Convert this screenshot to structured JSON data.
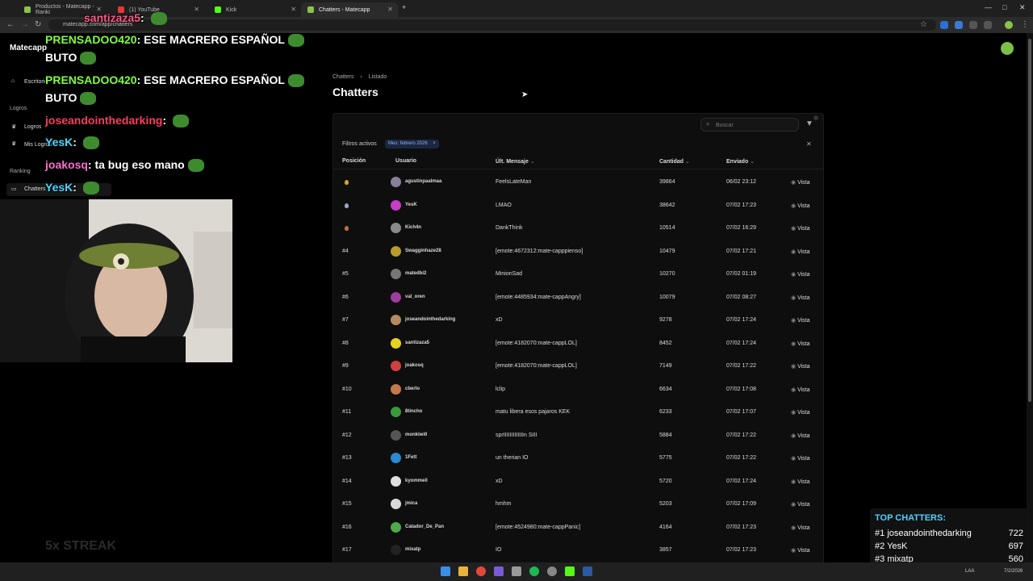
{
  "browser": {
    "tabs": [
      {
        "label": "Productos - Matecapp - Ranki",
        "active": false
      },
      {
        "label": "(1) YouTube",
        "active": false
      },
      {
        "label": "Kick",
        "active": false
      },
      {
        "label": "Chatters - Matecapp",
        "active": true
      }
    ],
    "url": "matecapp.com/app/chatters"
  },
  "app": {
    "brand": "Matecapp",
    "sidebar": {
      "item_escritorio": "Escritorio",
      "section_logros": "Logros",
      "item_logros": "Logros",
      "item_mis_logros": "Mis Logros",
      "section_ranking": "Ranking",
      "item_chatters": "Chatters"
    },
    "breadcrumb": [
      "Chatters",
      "Listado"
    ],
    "page_title": "Chatters",
    "search_placeholder": "Buscar",
    "filters_label": "Filtros activos",
    "filter_chip": "Mes: febrero 2026",
    "columns": {
      "position": "Posición",
      "user": "Usuario",
      "last_message": "Últ. Mensaje",
      "count": "Cantidad",
      "sent": "Enviado"
    },
    "view_label": "Vista",
    "rows": [
      {
        "pos": "",
        "medal": "gold",
        "user": "agustinpaalmaa",
        "msg": "FeelsLateMan",
        "count": "39864",
        "sent": "06/02 23:12",
        "avatar": "#8a7f9a"
      },
      {
        "pos": "",
        "medal": "silver",
        "user": "YesK",
        "msg": "LMAO",
        "count": "38642",
        "sent": "07/02 17:23",
        "avatar": "#c83cc8"
      },
      {
        "pos": "",
        "medal": "bronze",
        "user": "Kich4n",
        "msg": "DankThink",
        "count": "10514",
        "sent": "07/02 16:29",
        "avatar": "#8a8a8a"
      },
      {
        "pos": "#4",
        "medal": "",
        "user": "Swagginhaze28",
        "msg": "[emote:4672312:mate-capppienso]",
        "count": "10479",
        "sent": "07/02 17:21",
        "avatar": "#b89b2a"
      },
      {
        "pos": "#5",
        "medal": "",
        "user": "matedbi2",
        "msg": "MinionSad",
        "count": "10270",
        "sent": "07/02 01:19",
        "avatar": "#777777"
      },
      {
        "pos": "#6",
        "medal": "",
        "user": "val_oren",
        "msg": "[emote:4485934:mate-cappAngry]",
        "count": "10079",
        "sent": "07/02 08:27",
        "avatar": "#a03ca0"
      },
      {
        "pos": "#7",
        "medal": "",
        "user": "joseandointhedarking",
        "msg": "xD",
        "count": "9278",
        "sent": "07/02 17:24",
        "avatar": "#b58a5e"
      },
      {
        "pos": "#8",
        "medal": "",
        "user": "santizaza5",
        "msg": "[emote:4182070:mate-cappLOL]",
        "count": "8452",
        "sent": "07/02 17:24",
        "avatar": "#e6d21e"
      },
      {
        "pos": "#9",
        "medal": "",
        "user": "joakosq",
        "msg": "[emote:4182070:mate-cappLOL]",
        "count": "7149",
        "sent": "07/02 17:22",
        "avatar": "#d04040"
      },
      {
        "pos": "#10",
        "medal": "",
        "user": "cberlo",
        "msg": "lclip",
        "count": "6634",
        "sent": "07/02 17:08",
        "avatar": "#c7784a"
      },
      {
        "pos": "#11",
        "medal": "",
        "user": "8tincho",
        "msg": "matu libera esos pajaros KEK",
        "count": "6233",
        "sent": "07/02 17:07",
        "avatar": "#3a9a3a"
      },
      {
        "pos": "#12",
        "medal": "",
        "user": "monkiwi0",
        "msg": "sprIIIIIIIIIIIIIn SIII",
        "count": "5884",
        "sent": "07/02 17:22",
        "avatar": "#555555"
      },
      {
        "pos": "#13",
        "medal": "",
        "user": "1Fett",
        "msg": "un therian IO",
        "count": "5775",
        "sent": "07/02 17:22",
        "avatar": "#2a8ad0"
      },
      {
        "pos": "#14",
        "medal": "",
        "user": "kyommeil",
        "msg": "xD",
        "count": "5720",
        "sent": "07/02 17:24",
        "avatar": "#e0e0e0"
      },
      {
        "pos": "#15",
        "medal": "",
        "user": "jmica",
        "msg": "hmhm",
        "count": "5203",
        "sent": "07/02 17:09",
        "avatar": "#d8d8d8"
      },
      {
        "pos": "#16",
        "medal": "",
        "user": "Catador_De_Pan",
        "msg": "[emote:4524980:mate-cappPanic]",
        "count": "4164",
        "sent": "07/02 17:23",
        "avatar": "#4caa4c"
      },
      {
        "pos": "#17",
        "medal": "",
        "user": "mixatp",
        "msg": "IO",
        "count": "3857",
        "sent": "07/02 17:23",
        "avatar": "#222222"
      }
    ]
  },
  "overlay": {
    "chat": [
      {
        "user": "santizaza5",
        "text": "",
        "color": "#ff5c8a"
      },
      {
        "user": "PRENSADOO420",
        "text": "ESE MACRERO ESPAÑOL",
        "color": "#7fff3a"
      },
      {
        "user": "",
        "text": "BUTO",
        "color": "#7fff3a"
      },
      {
        "user": "PRENSADOO420",
        "text": "ESE MACRERO ESPAÑOL",
        "color": "#7fff3a"
      },
      {
        "user": "",
        "text": "BUTO",
        "color": "#7fff3a"
      },
      {
        "user": "joseandointhedarking",
        "text": "",
        "color": "#ff3b5c"
      },
      {
        "user": "YesK",
        "text": "",
        "color": "#4fd8ff"
      },
      {
        "user": "joakosq",
        "text": "ta bug eso mano",
        "color": "#ff6bd0"
      },
      {
        "user": "YesK",
        "text": "",
        "color": "#4fd8ff"
      }
    ],
    "streak": "5x STREAK",
    "top_chatters_title": "TOP CHATTERS:",
    "top_chatters": [
      {
        "rank": "#1",
        "name": "joseandointhedarking",
        "count": "722"
      },
      {
        "rank": "#2",
        "name": "YesK",
        "count": "697"
      },
      {
        "rank": "#3",
        "name": "mixatp",
        "count": "560"
      }
    ]
  },
  "taskbar": {
    "lang": "LAA",
    "date": "7/2/2026"
  }
}
